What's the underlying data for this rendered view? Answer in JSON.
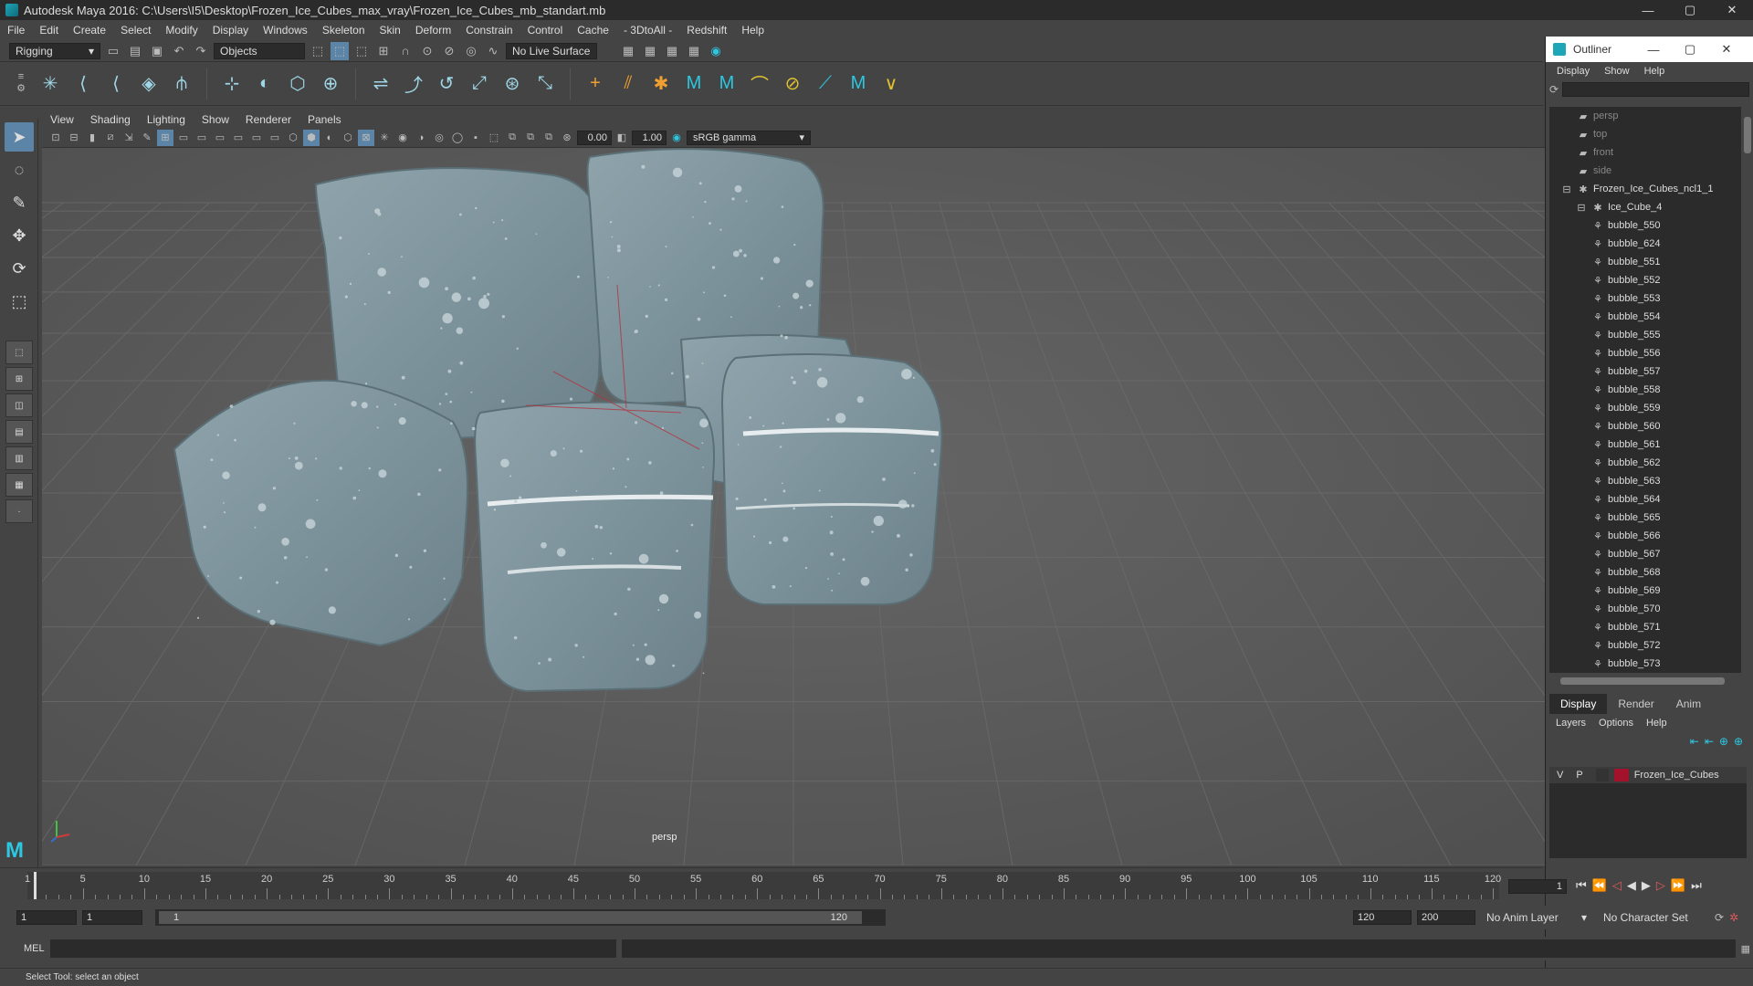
{
  "app": {
    "title": "Autodesk Maya 2016: C:\\Users\\I5\\Desktop\\Frozen_Ice_Cubes_max_vray\\Frozen_Ice_Cubes_mb_standart.mb"
  },
  "menu": [
    "File",
    "Edit",
    "Create",
    "Select",
    "Modify",
    "Display",
    "Windows",
    "Skeleton",
    "Skin",
    "Deform",
    "Constrain",
    "Control",
    "Cache",
    "- 3DtoAll -",
    "Redshift",
    "Help"
  ],
  "statusline": {
    "mode": "Rigging",
    "selection_mask": "Objects",
    "live_surface": "No Live Surface"
  },
  "viewport": {
    "menu": [
      "View",
      "Shading",
      "Lighting",
      "Show",
      "Renderer",
      "Panels"
    ],
    "near_value": "0.00",
    "far_value": "1.00",
    "color_space": "sRGB gamma",
    "camera_label": "persp"
  },
  "outliner": {
    "title": "Outliner",
    "menu": [
      "Display",
      "Show",
      "Help"
    ],
    "cameras": [
      "persp",
      "top",
      "front",
      "side"
    ],
    "group": "Frozen_Ice_Cubes_ncl1_1",
    "subgroup": "Ice_Cube_4",
    "items": [
      "bubble_550",
      "bubble_624",
      "bubble_551",
      "bubble_552",
      "bubble_553",
      "bubble_554",
      "bubble_555",
      "bubble_556",
      "bubble_557",
      "bubble_558",
      "bubble_559",
      "bubble_560",
      "bubble_561",
      "bubble_562",
      "bubble_563",
      "bubble_564",
      "bubble_565",
      "bubble_566",
      "bubble_567",
      "bubble_568",
      "bubble_569",
      "bubble_570",
      "bubble_571",
      "bubble_572",
      "bubble_573"
    ]
  },
  "layers": {
    "tabs": [
      "Display",
      "Render",
      "Anim"
    ],
    "menu": [
      "Layers",
      "Options",
      "Help"
    ],
    "layer": {
      "v": "V",
      "p": "P",
      "name": "Frozen_Ice_Cubes",
      "color": "#a3122b"
    }
  },
  "timeline": {
    "ticks": [
      "5",
      "10",
      "15",
      "20",
      "25",
      "30",
      "35",
      "40",
      "45",
      "50",
      "55",
      "60",
      "65",
      "70",
      "75",
      "80",
      "85",
      "90",
      "95",
      "100",
      "105",
      "110",
      "115",
      "120"
    ],
    "start_label": "1",
    "current_frame": "1"
  },
  "range": {
    "start": "1",
    "current": "1",
    "slider_start": "1",
    "slider_end": "120",
    "end": "120",
    "max": "200",
    "anim_layer": "No Anim Layer",
    "char_set": "No Character Set"
  },
  "command": {
    "label": "MEL"
  },
  "help": {
    "text": "Select Tool: select an object"
  }
}
